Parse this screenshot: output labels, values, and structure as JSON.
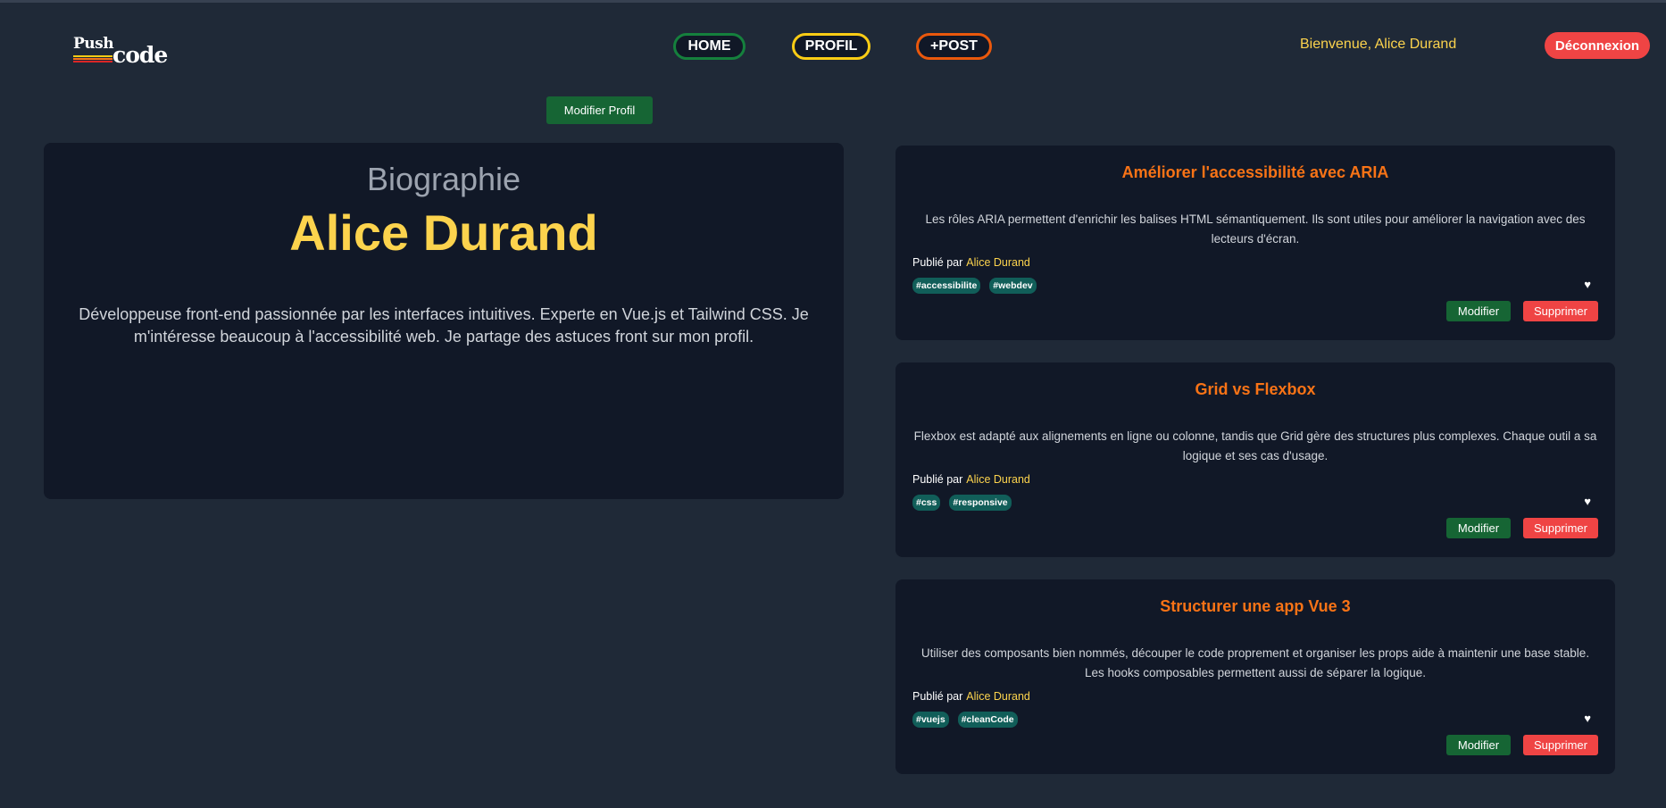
{
  "header": {
    "logo": {
      "word1": "Push",
      "word2": "code"
    },
    "nav": [
      {
        "label": "HOME",
        "color": "#15803d"
      },
      {
        "label": "PROFIL",
        "color": "#facc15"
      },
      {
        "label": "+POST",
        "color": "#ea580c"
      }
    ],
    "welcome": "Bienvenue, Alice Durand",
    "logout_label": "Déconnexion"
  },
  "profile": {
    "edit_label": "Modifier Profil",
    "bio_heading": "Biographie",
    "name": "Alice Durand",
    "bio": "Développeuse front-end passionnée par les interfaces intuitives. Experte en Vue.js et Tailwind CSS. Je m'intéresse beaucoup à l'accessibilité web. Je partage des astuces front sur mon profil."
  },
  "posts": [
    {
      "title": "Améliorer l'accessibilité avec ARIA",
      "body": "Les rôles ARIA permettent d'enrichir les balises HTML sémantiquement. Ils sont utiles pour améliorer la navigation avec des lecteurs d'écran.",
      "published_by": "Publié par",
      "author": "Alice Durand",
      "tags": [
        "#accessibilite",
        "#webdev"
      ],
      "edit_label": "Modifier",
      "delete_label": "Supprimer"
    },
    {
      "title": "Grid vs Flexbox",
      "body": "Flexbox est adapté aux alignements en ligne ou colonne, tandis que Grid gère des structures plus complexes. Chaque outil a sa logique et ses cas d'usage.",
      "published_by": "Publié par",
      "author": "Alice Durand",
      "tags": [
        "#css",
        "#responsive"
      ],
      "edit_label": "Modifier",
      "delete_label": "Supprimer"
    },
    {
      "title": "Structurer une app Vue 3",
      "body": "Utiliser des composants bien nommés, découper le code proprement et organiser les props aide à maintenir une base stable. Les hooks composables permettent aussi de séparer la logique.",
      "published_by": "Publié par",
      "author": "Alice Durand",
      "tags": [
        "#vuejs",
        "#cleanCode"
      ],
      "edit_label": "Modifier",
      "delete_label": "Supprimer"
    }
  ],
  "colors": {
    "background": "#1f2937",
    "card": "#111827",
    "accent_yellow": "#fcd34d",
    "accent_orange": "#f97316",
    "danger": "#ef4444",
    "success": "#166534",
    "tag": "#115e59"
  }
}
